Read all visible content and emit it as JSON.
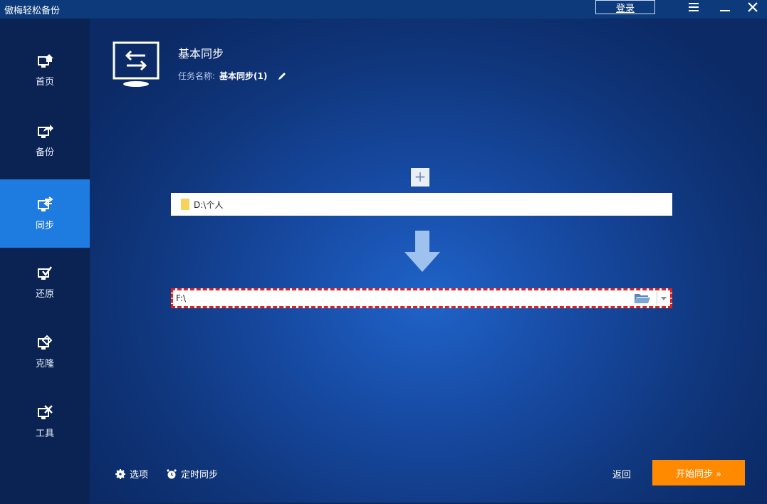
{
  "app": {
    "title": "傲梅轻松备份"
  },
  "titlebar": {
    "login_label": "登录",
    "menu_icon": "menu-icon",
    "minimize_icon": "minimize-icon",
    "close_icon": "close-icon"
  },
  "sidebar": {
    "items": [
      {
        "label": "首页",
        "icon": "home-icon",
        "active": false
      },
      {
        "label": "备份",
        "icon": "backup-icon",
        "active": false
      },
      {
        "label": "同步",
        "icon": "sync-icon",
        "active": true
      },
      {
        "label": "还原",
        "icon": "restore-icon",
        "active": false
      },
      {
        "label": "克隆",
        "icon": "clone-icon",
        "active": false
      },
      {
        "label": "工具",
        "icon": "tools-icon",
        "active": false
      }
    ]
  },
  "header": {
    "title": "基本同步",
    "task_label": "任务名称:",
    "task_name": "基本同步(1)"
  },
  "source": {
    "path": "D:\\个人",
    "add_label": "+"
  },
  "destination": {
    "path": "F:\\"
  },
  "footer": {
    "options_label": "选项",
    "schedule_label": "定时同步",
    "back_label": "返回",
    "start_label": "开始同步 »"
  },
  "colors": {
    "accent": "#1e7be0",
    "start_button": "#ff8a00",
    "dest_border": "#e0201f"
  }
}
